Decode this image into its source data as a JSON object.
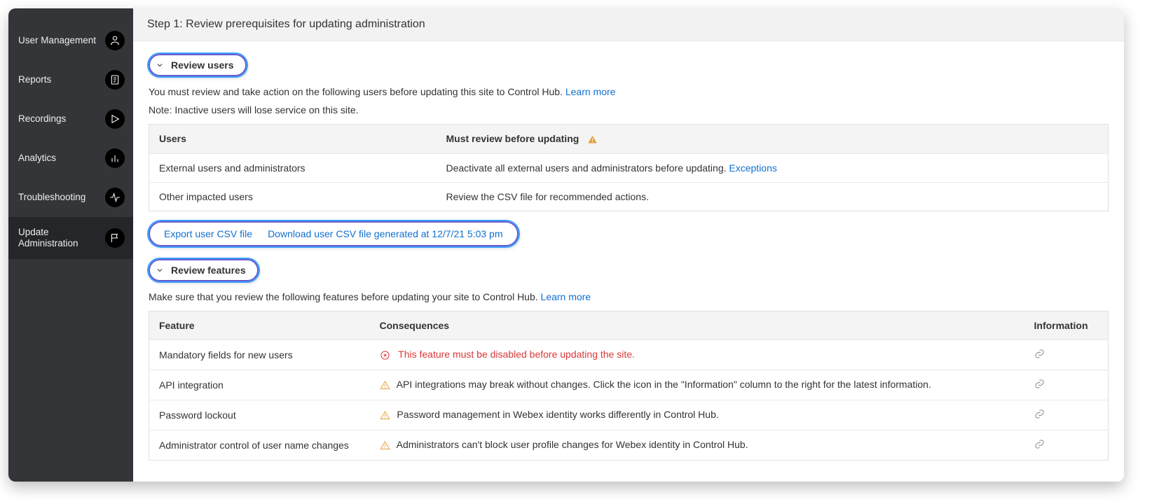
{
  "sidebar": {
    "items": [
      {
        "label": "User Management",
        "icon": "user-icon"
      },
      {
        "label": "Reports",
        "icon": "document-icon"
      },
      {
        "label": "Recordings",
        "icon": "play-icon"
      },
      {
        "label": "Analytics",
        "icon": "bars-icon"
      },
      {
        "label": "Troubleshooting",
        "icon": "activity-icon"
      },
      {
        "label": "Update Administration",
        "icon": "flag-icon"
      }
    ]
  },
  "step_header": "Step 1: Review prerequisites for updating administration",
  "review_users": {
    "toggle_label": "Review users",
    "intro": "You must review and take action on the following users before updating this site to Control Hub.",
    "learn_more": "Learn more",
    "note": "Note: Inactive users will lose service on this site.",
    "table": {
      "col_users": "Users",
      "col_review": "Must review before updating",
      "rows": [
        {
          "users": "External users and administrators",
          "review": "Deactivate all external users and administrators before updating.",
          "link": "Exceptions"
        },
        {
          "users": "Other impacted users",
          "review": "Review the CSV file for recommended actions."
        }
      ]
    },
    "csv": {
      "export_label": "Export user CSV file",
      "download_label": "Download user CSV file generated at 12/7/21 5:03 pm"
    }
  },
  "review_features": {
    "toggle_label": "Review features",
    "intro": "Make sure that you review the following features before updating your site to Control Hub.",
    "learn_more": "Learn more",
    "table": {
      "col_feature": "Feature",
      "col_consequences": "Consequences",
      "col_info": "Information",
      "rows": [
        {
          "feature": "Mandatory fields for new users",
          "level": "error",
          "consequence": "This feature must be disabled before updating the site."
        },
        {
          "feature": "API integration",
          "level": "warn",
          "consequence": "API integrations may break without changes. Click the icon in the \"Information\" column to the right for the latest information."
        },
        {
          "feature": "Password lockout",
          "level": "warn",
          "consequence": "Password management in Webex identity works differently in Control Hub."
        },
        {
          "feature": "Administrator control of user name changes",
          "level": "warn",
          "consequence": "Administrators can't block user profile changes for Webex identity in Control Hub."
        }
      ]
    }
  }
}
